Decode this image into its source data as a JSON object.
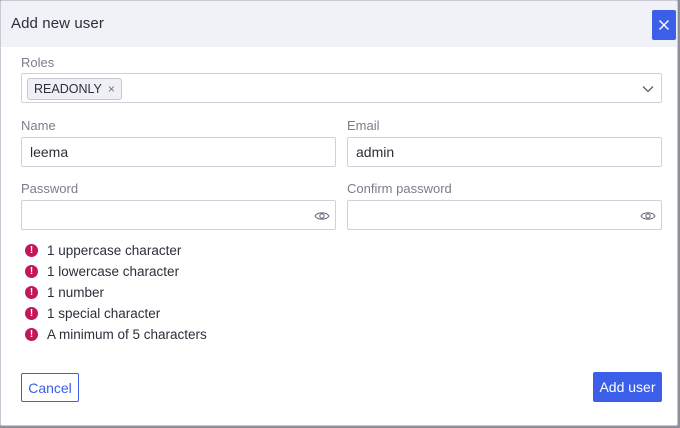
{
  "dialog": {
    "title": "Add new user"
  },
  "roles": {
    "label": "Roles",
    "selected": [
      "READONLY"
    ],
    "remove_glyph": "×"
  },
  "name": {
    "label": "Name",
    "value": "leema"
  },
  "email": {
    "label": "Email",
    "value": "admin"
  },
  "password": {
    "label": "Password",
    "value": ""
  },
  "confirm_password": {
    "label": "Confirm password",
    "value": ""
  },
  "requirements": [
    "1 uppercase character",
    "1 lowercase character",
    "1 number",
    "1 special character",
    "A minimum of 5 characters"
  ],
  "requirement_glyph": "!",
  "buttons": {
    "cancel": "Cancel",
    "add": "Add user"
  },
  "colors": {
    "accent": "#3b5fe8",
    "error": "#c2185b",
    "header_bg": "#f1f1f8"
  },
  "icons": {
    "close": "close-icon",
    "dropdown": "chevron-down-icon",
    "show_password": "eye-icon",
    "requirement": "exclamation-circle-icon"
  }
}
